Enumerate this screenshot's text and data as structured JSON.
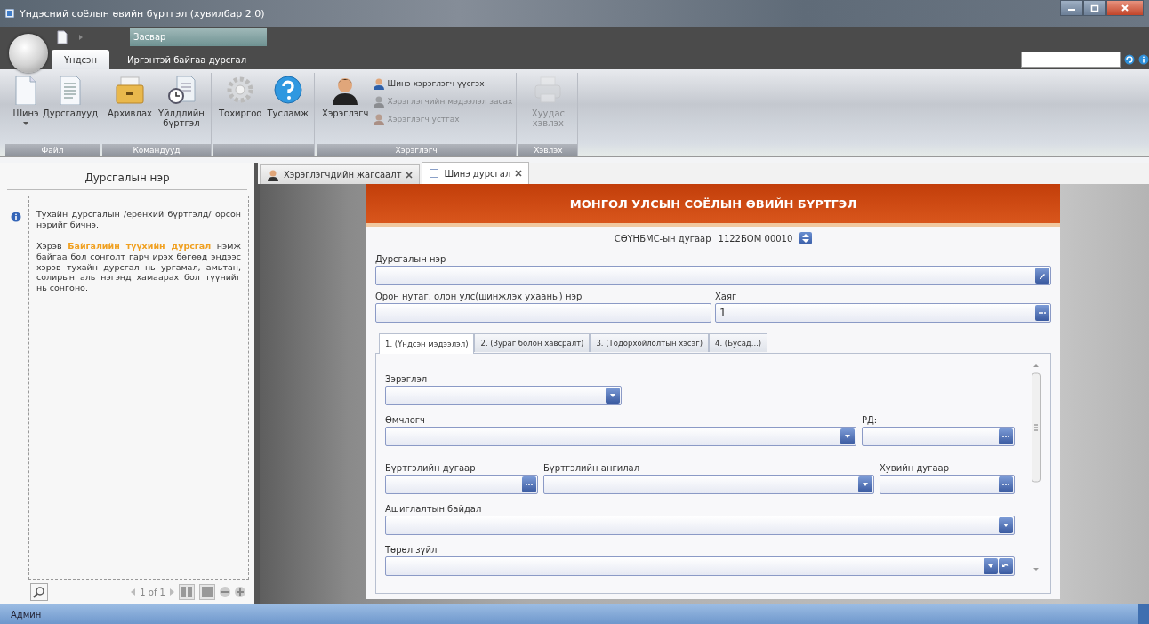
{
  "window": {
    "title": "Үндэсний соёлын өвийн бүртгэл (хувилбар 2.0)"
  },
  "ribbon": {
    "context_label": "Засвар",
    "tabs": [
      {
        "label": "Үндсэн",
        "selected": true
      },
      {
        "label": "Иргэнтэй байгаа дурсгал",
        "selected": false
      }
    ],
    "groups": [
      {
        "label": "Файл",
        "buttons": [
          {
            "label": "Шинэ",
            "kind": "large",
            "disabled": false,
            "dropdown": true
          },
          {
            "label": "Дурсгалууд",
            "kind": "large",
            "disabled": false,
            "dropdown": false
          }
        ]
      },
      {
        "label": "Командууд",
        "buttons": [
          {
            "label": "Архивлах",
            "kind": "large",
            "disabled": false,
            "dropdown": false
          },
          {
            "label": "Үйлдлийн бүртгэл",
            "kind": "large",
            "disabled": false,
            "dropdown": false
          }
        ]
      },
      {
        "buttons": [
          {
            "label": "Тохиргоо",
            "kind": "large",
            "disabled": false,
            "dropdown": false
          },
          {
            "label": "Тусламж",
            "kind": "large",
            "disabled": false,
            "dropdown": false
          }
        ]
      },
      {
        "label": "Хэрэглэгч",
        "buttons": [
          {
            "label": "Хэрэглэгч",
            "kind": "large",
            "disabled": false,
            "dropdown": false
          },
          {
            "label": "Шинэ хэрэглэгч үүсгэх",
            "kind": "small",
            "disabled": false,
            "dropdown": false
          },
          {
            "label": "Хэрэглэгчийн мэдээлэл засах",
            "kind": "small",
            "disabled": true,
            "dropdown": false
          },
          {
            "label": "Хэрэглэгч устгах",
            "kind": "small",
            "disabled": true,
            "dropdown": false
          }
        ]
      },
      {
        "label": "Хэвлэх",
        "buttons": [
          {
            "label": "Хуудас хэвлэх",
            "kind": "large",
            "disabled": true,
            "dropdown": false
          }
        ]
      }
    ]
  },
  "left_panel": {
    "title": "Дурсгалын нэр",
    "paragraphs": [
      "Тухайн дурсгалын /ерөнхий бүртгэлд/ орсон нэрийг бичнэ.",
      "Хэрэв **Байгалийн түүхийн дурсгал** нэмж байгаа бол сонголт гарч ирэх бөгөөд эндээс хэрэв тухайн дурсгал нь ургамал, амьтан, солирын аль нэгэнд хамаарах бол түүнийг нь сонгоно."
    ],
    "pager": "1 of 1"
  },
  "documents": {
    "tabs": [
      {
        "label": "Хэрэглэгчдийн жагсаалт",
        "selected": false
      },
      {
        "label": "Шинэ дурсгал",
        "selected": true
      }
    ]
  },
  "form": {
    "title": "МОНГОЛ УЛСЫН СОЁЛЫН ӨВИЙН БҮРТГЭЛ",
    "number_label": "СӨҮНБМС-ын дугаар",
    "number_value": "1122БОМ 00010",
    "top_rows": [
      [
        {
          "label": "Дурсгалын нэр",
          "kind": "edit"
        }
      ],
      [
        {
          "label": "Орон нутаг, олон улс(шинжлэх ухааны) нэр",
          "kind": "text"
        },
        {
          "label": "Хаяг",
          "kind": "ellipsis",
          "value": "1"
        }
      ]
    ],
    "tabs": [
      {
        "label": "1. (Үндсэн мэдээлэл)",
        "selected": true
      },
      {
        "label": "2. (Зураг болон хавсралт)",
        "selected": false
      },
      {
        "label": "3. (Тодорхойлолтын хэсэг)",
        "selected": false
      },
      {
        "label": "4. (Бусад...)",
        "selected": false
      }
    ],
    "rows": [
      [
        {
          "label": "Зэрэглэл",
          "kind": "combo"
        }
      ],
      [
        {
          "label": "Өмчлөгч",
          "kind": "combo"
        },
        {
          "label": "РД:",
          "kind": "ellipsis"
        }
      ],
      [
        {
          "label": "Бүртгэлийн дугаар",
          "kind": "ellipsis"
        },
        {
          "label": "Бүртгэлийн ангилал",
          "kind": "combo"
        },
        {
          "label": "Хувийн дугаар",
          "kind": "ellipsis"
        }
      ],
      [
        {
          "label": "Ашиглалтын байдал",
          "kind": "combo"
        }
      ],
      [
        {
          "label": "Төрөл зүйл",
          "kind": "combo_extra"
        }
      ]
    ]
  },
  "status_bar": {
    "user": "Админ"
  }
}
